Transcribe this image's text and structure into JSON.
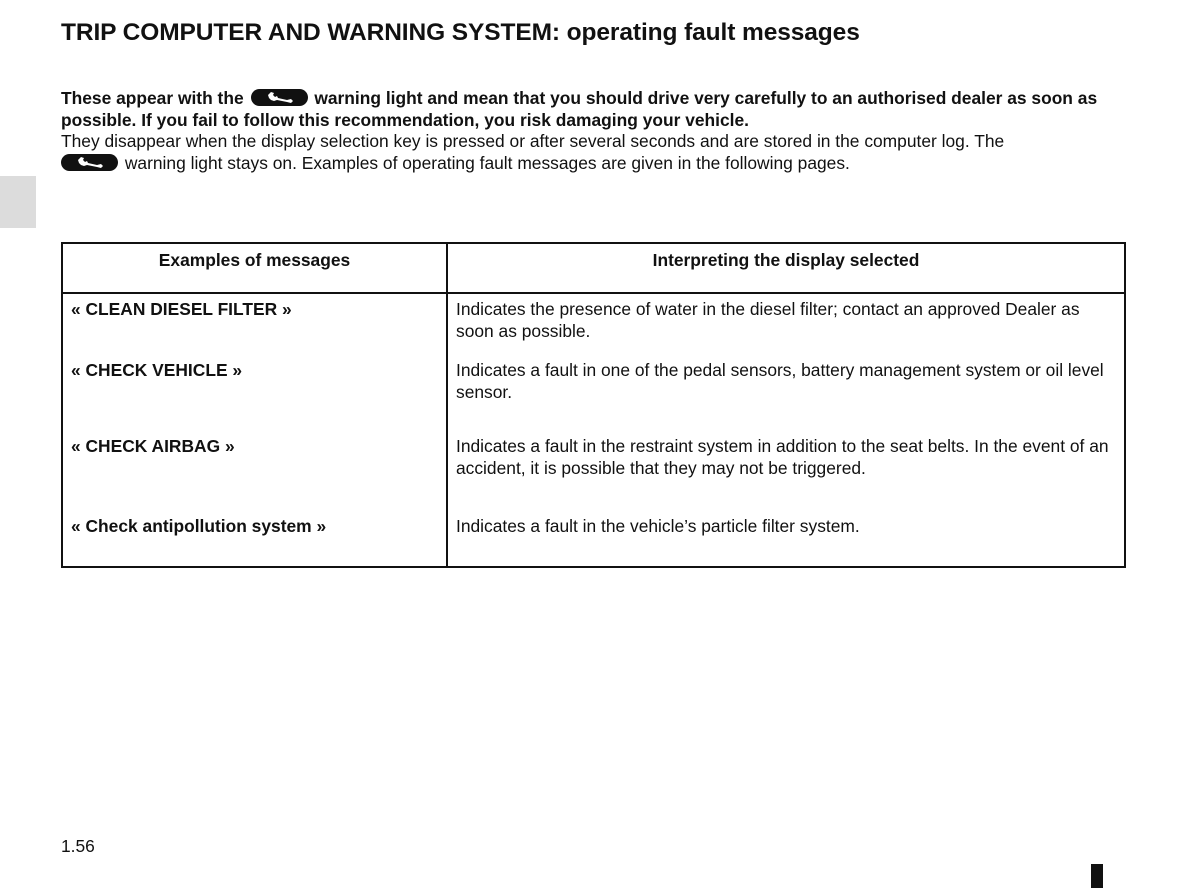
{
  "page": {
    "title": "TRIP COMPUTER AND WARNING SYSTEM: operating fault messages",
    "page_number": "1.56"
  },
  "intro": {
    "bold_part1": "These appear with the",
    "bold_part2": "warning light and mean that you should drive very carefully to an authorised dealer as soon as possible. If you fail to follow this recommendation, you risk damaging your vehicle.",
    "normal_line1": "They disappear when the display selection key is pressed or after several seconds and are stored in the computer log. The",
    "normal_line2": "warning light stays on. Examples of operating fault messages are given in the following pages.",
    "icon": "wrench-warning-light-icon"
  },
  "table": {
    "headers": [
      "Examples of messages",
      "Interpreting the display selected"
    ],
    "rows": [
      {
        "message": "« CLEAN DIESEL FILTER »",
        "interpretation": "Indicates the presence of water in the diesel filter; contact an approved Dealer as soon as possible."
      },
      {
        "message": "« CHECK VEHICLE »",
        "interpretation": "Indicates a fault in one of the pedal sensors, battery management system or oil level sensor."
      },
      {
        "message": "« CHECK AIRBAG »",
        "interpretation": "Indicates a fault in the restraint system in addition to the seat belts. In the event of an accident, it is possible that they may not be triggered."
      },
      {
        "message": "« Check antipollution system »",
        "interpretation": "Indicates a fault in the vehicle’s particle filter system."
      }
    ]
  }
}
